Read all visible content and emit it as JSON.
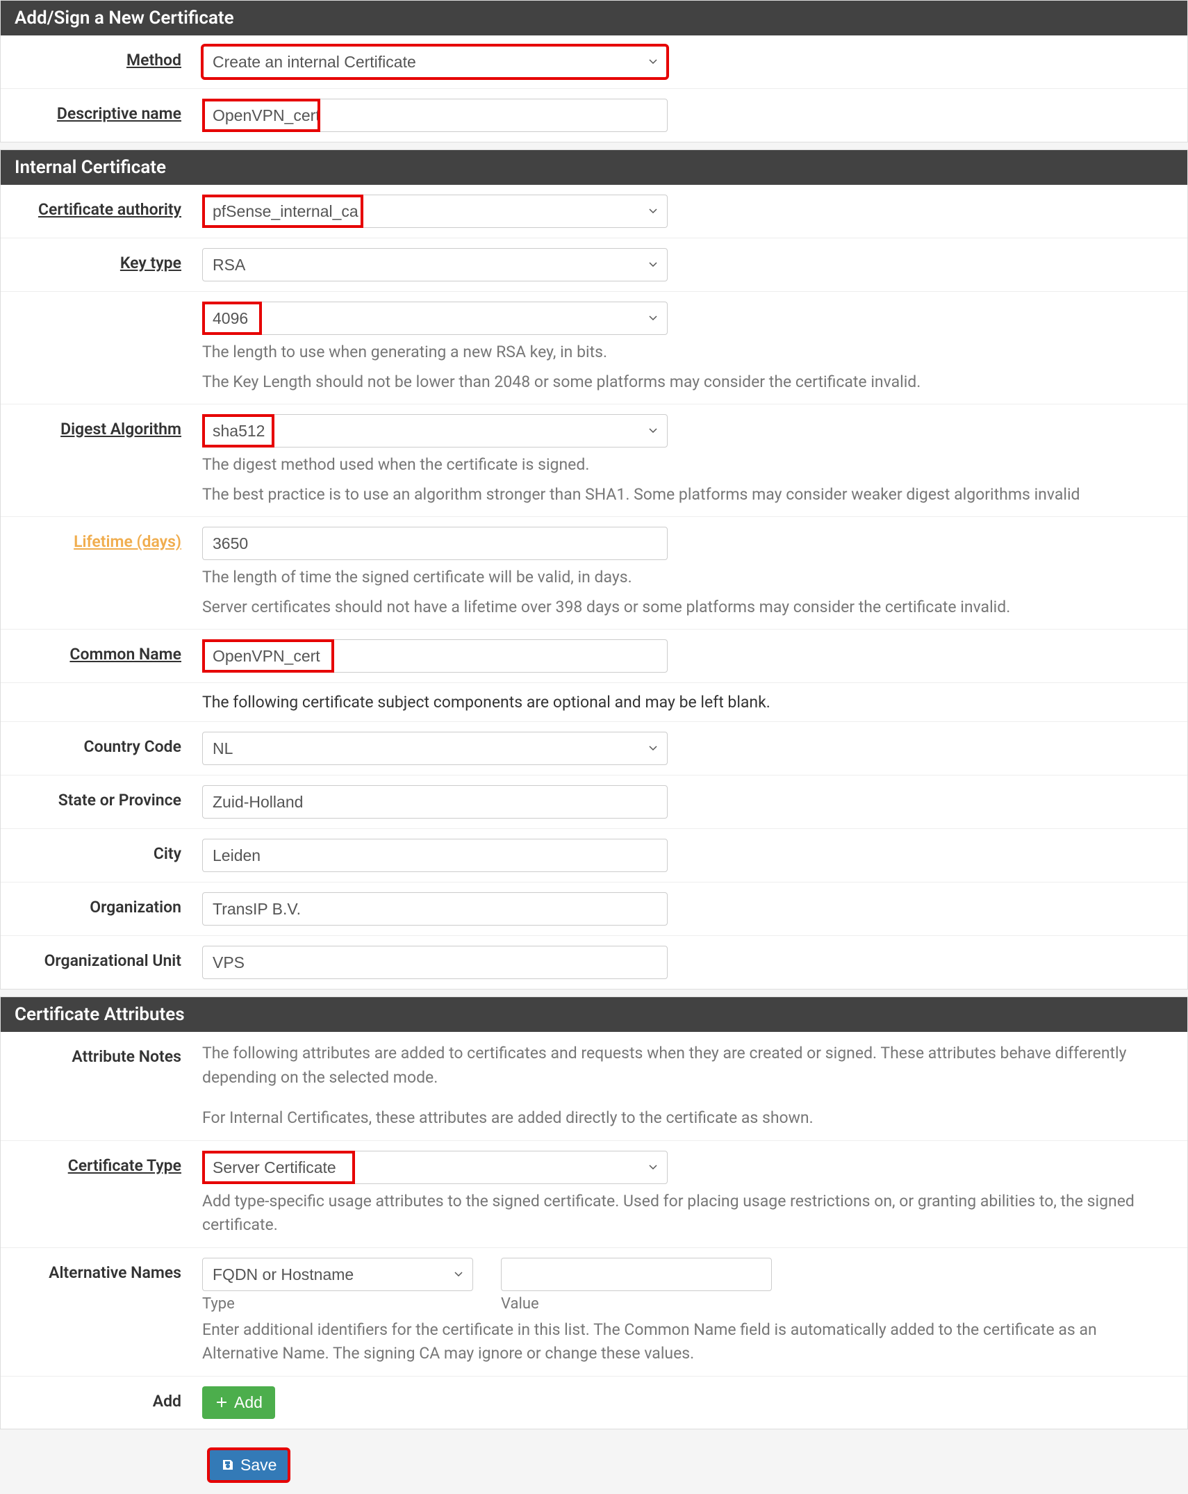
{
  "section1": {
    "title": "Add/Sign a New Certificate",
    "method_label": "Method",
    "method_value": "Create an internal Certificate",
    "descname_label": "Descriptive name",
    "descname_value": "OpenVPN_cert"
  },
  "section2": {
    "title": "Internal Certificate",
    "ca_label": "Certificate authority",
    "ca_value": "pfSense_internal_ca",
    "keytype_label": "Key type",
    "keytype_value": "RSA",
    "keylen_value": "4096",
    "keylen_help1": "The length to use when generating a new RSA key, in bits.",
    "keylen_help2": "The Key Length should not be lower than 2048 or some platforms may consider the certificate invalid.",
    "digest_label": "Digest Algorithm",
    "digest_value": "sha512",
    "digest_help1": "The digest method used when the certificate is signed.",
    "digest_help2": "The best practice is to use an algorithm stronger than SHA1. Some platforms may consider weaker digest algorithms invalid",
    "lifetime_label": "Lifetime (days)",
    "lifetime_value": "3650",
    "lifetime_help1": "The length of time the signed certificate will be valid, in days.",
    "lifetime_help2": "Server certificates should not have a lifetime over 398 days or some platforms may consider the certificate invalid.",
    "cn_label": "Common Name",
    "cn_value": "OpenVPN_cert",
    "optional_note": "The following certificate subject components are optional and may be left blank.",
    "country_label": "Country Code",
    "country_value": "NL",
    "state_label": "State or Province",
    "state_value": "Zuid-Holland",
    "city_label": "City",
    "city_value": "Leiden",
    "org_label": "Organization",
    "org_value": "TransIP B.V.",
    "ou_label": "Organizational Unit",
    "ou_value": "VPS"
  },
  "section3": {
    "title": "Certificate Attributes",
    "attrnotes_label": "Attribute Notes",
    "attrnotes_text1": "The following attributes are added to certificates and requests when they are created or signed. These attributes behave differently depending on the selected mode.",
    "attrnotes_text2": "For Internal Certificates, these attributes are added directly to the certificate as shown.",
    "certtype_label": "Certificate Type",
    "certtype_value": "Server Certificate",
    "certtype_help": "Add type-specific usage attributes to the signed certificate. Used for placing usage restrictions on, or granting abilities to, the signed certificate.",
    "altnames_label": "Alternative Names",
    "altnames_type_value": "FQDN or Hostname",
    "altnames_type_sub": "Type",
    "altnames_value_sub": "Value",
    "altnames_help": "Enter additional identifiers for the certificate in this list. The Common Name field is automatically added to the certificate as an Alternative Name. The signing CA may ignore or change these values.",
    "add_label": "Add",
    "add_btn": "Add",
    "save_btn": "Save"
  }
}
